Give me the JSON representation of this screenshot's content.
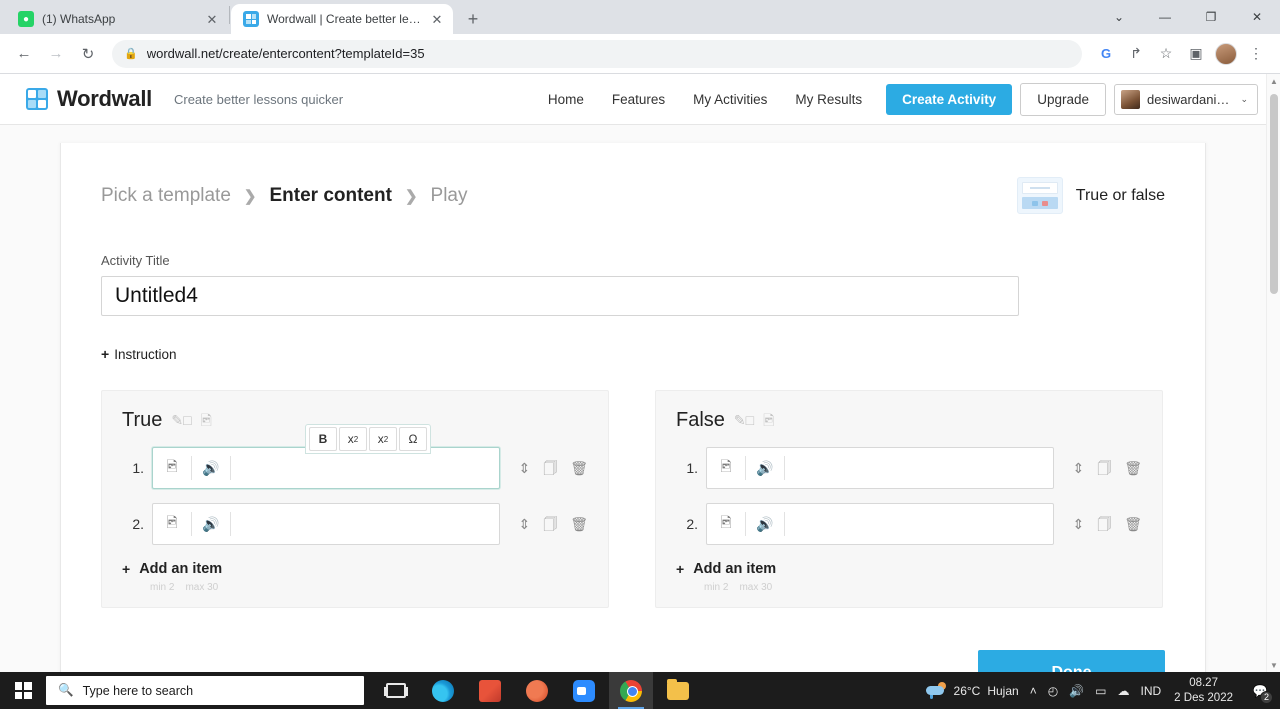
{
  "browser": {
    "tabs": [
      {
        "title": "(1) WhatsApp",
        "favicon": "whatsapp-icon",
        "active": false
      },
      {
        "title": "Wordwall | Create better lessons",
        "favicon": "wordwall-icon",
        "active": true
      }
    ],
    "new_tab_label": "+",
    "window_controls": {
      "minimize": "—",
      "maximize": "❐",
      "close": "✕",
      "more": "⌄"
    },
    "nav": {
      "back": "←",
      "forward": "→",
      "reload": "↻"
    },
    "omnibox": {
      "lock": "🔒",
      "url": "wordwall.net/create/entercontent?templateId=35"
    },
    "toolbar_right": {
      "google": "G",
      "share": "↱",
      "bookmark": "☆",
      "extension": "▣",
      "menu": "⋮"
    }
  },
  "site": {
    "brand_name": "Wordwall",
    "tagline": "Create better lessons quicker",
    "nav_links": [
      "Home",
      "Features",
      "My Activities",
      "My Results"
    ],
    "create_button": "Create Activity",
    "upgrade_button": "Upgrade",
    "user_name": "desiwardanin...",
    "caret": "⌄"
  },
  "breadcrumb": {
    "steps": [
      {
        "label": "Pick a template",
        "active": false
      },
      {
        "label": "Enter content",
        "active": true
      },
      {
        "label": "Play",
        "active": false
      }
    ],
    "separator": "❯"
  },
  "template": {
    "name": "True or false"
  },
  "form": {
    "title_label": "Activity Title",
    "title_value": "Untitled4",
    "title_placeholder": "Activity Title",
    "instruction_label": "Instruction",
    "instruction_plus": "+"
  },
  "rte_toolbar": {
    "buttons": [
      {
        "name": "bold",
        "label": "B"
      },
      {
        "name": "superscript",
        "label": "x",
        "script": "2"
      },
      {
        "name": "subscript",
        "label": "x",
        "script": "2"
      },
      {
        "name": "symbol",
        "label": "Ω"
      }
    ]
  },
  "columns": [
    {
      "title": "True",
      "edit_icon": "pencil-icon",
      "image_icon": "image-icon",
      "items": [
        {
          "number": "1.",
          "value": "",
          "focused": true
        },
        {
          "number": "2.",
          "value": "",
          "focused": false
        }
      ],
      "add_label": "Add an item",
      "add_plus": "+",
      "min_label": "min 2",
      "max_label": "max 30"
    },
    {
      "title": "False",
      "edit_icon": "pencil-icon",
      "image_icon": "image-icon",
      "items": [
        {
          "number": "1.",
          "value": "",
          "focused": false
        },
        {
          "number": "2.",
          "value": "",
          "focused": false
        }
      ],
      "add_label": "Add an item",
      "add_plus": "+",
      "min_label": "min 2",
      "max_label": "max 30"
    }
  ],
  "actions": {
    "done_label": "Done"
  },
  "taskbar": {
    "search_placeholder": "Type here to search",
    "apps": [
      "task-view",
      "edge",
      "office",
      "powerpoint",
      "zoom",
      "chrome",
      "file-explorer"
    ],
    "weather_temp": "26°C",
    "weather_desc": "Hujan",
    "language": "IND",
    "time": "08.27",
    "date": "2 Des 2022",
    "notification_count": "2",
    "tray_icons": {
      "chevron": "˄",
      "network": "◴",
      "volume": "🔊",
      "battery": "▭",
      "cloud": "☁"
    }
  },
  "colors": {
    "accent": "#2cabe3",
    "page_bg": "#fafafa",
    "panel_bg": "#f7f7f7",
    "taskbar_bg": "#1c1c1c"
  }
}
